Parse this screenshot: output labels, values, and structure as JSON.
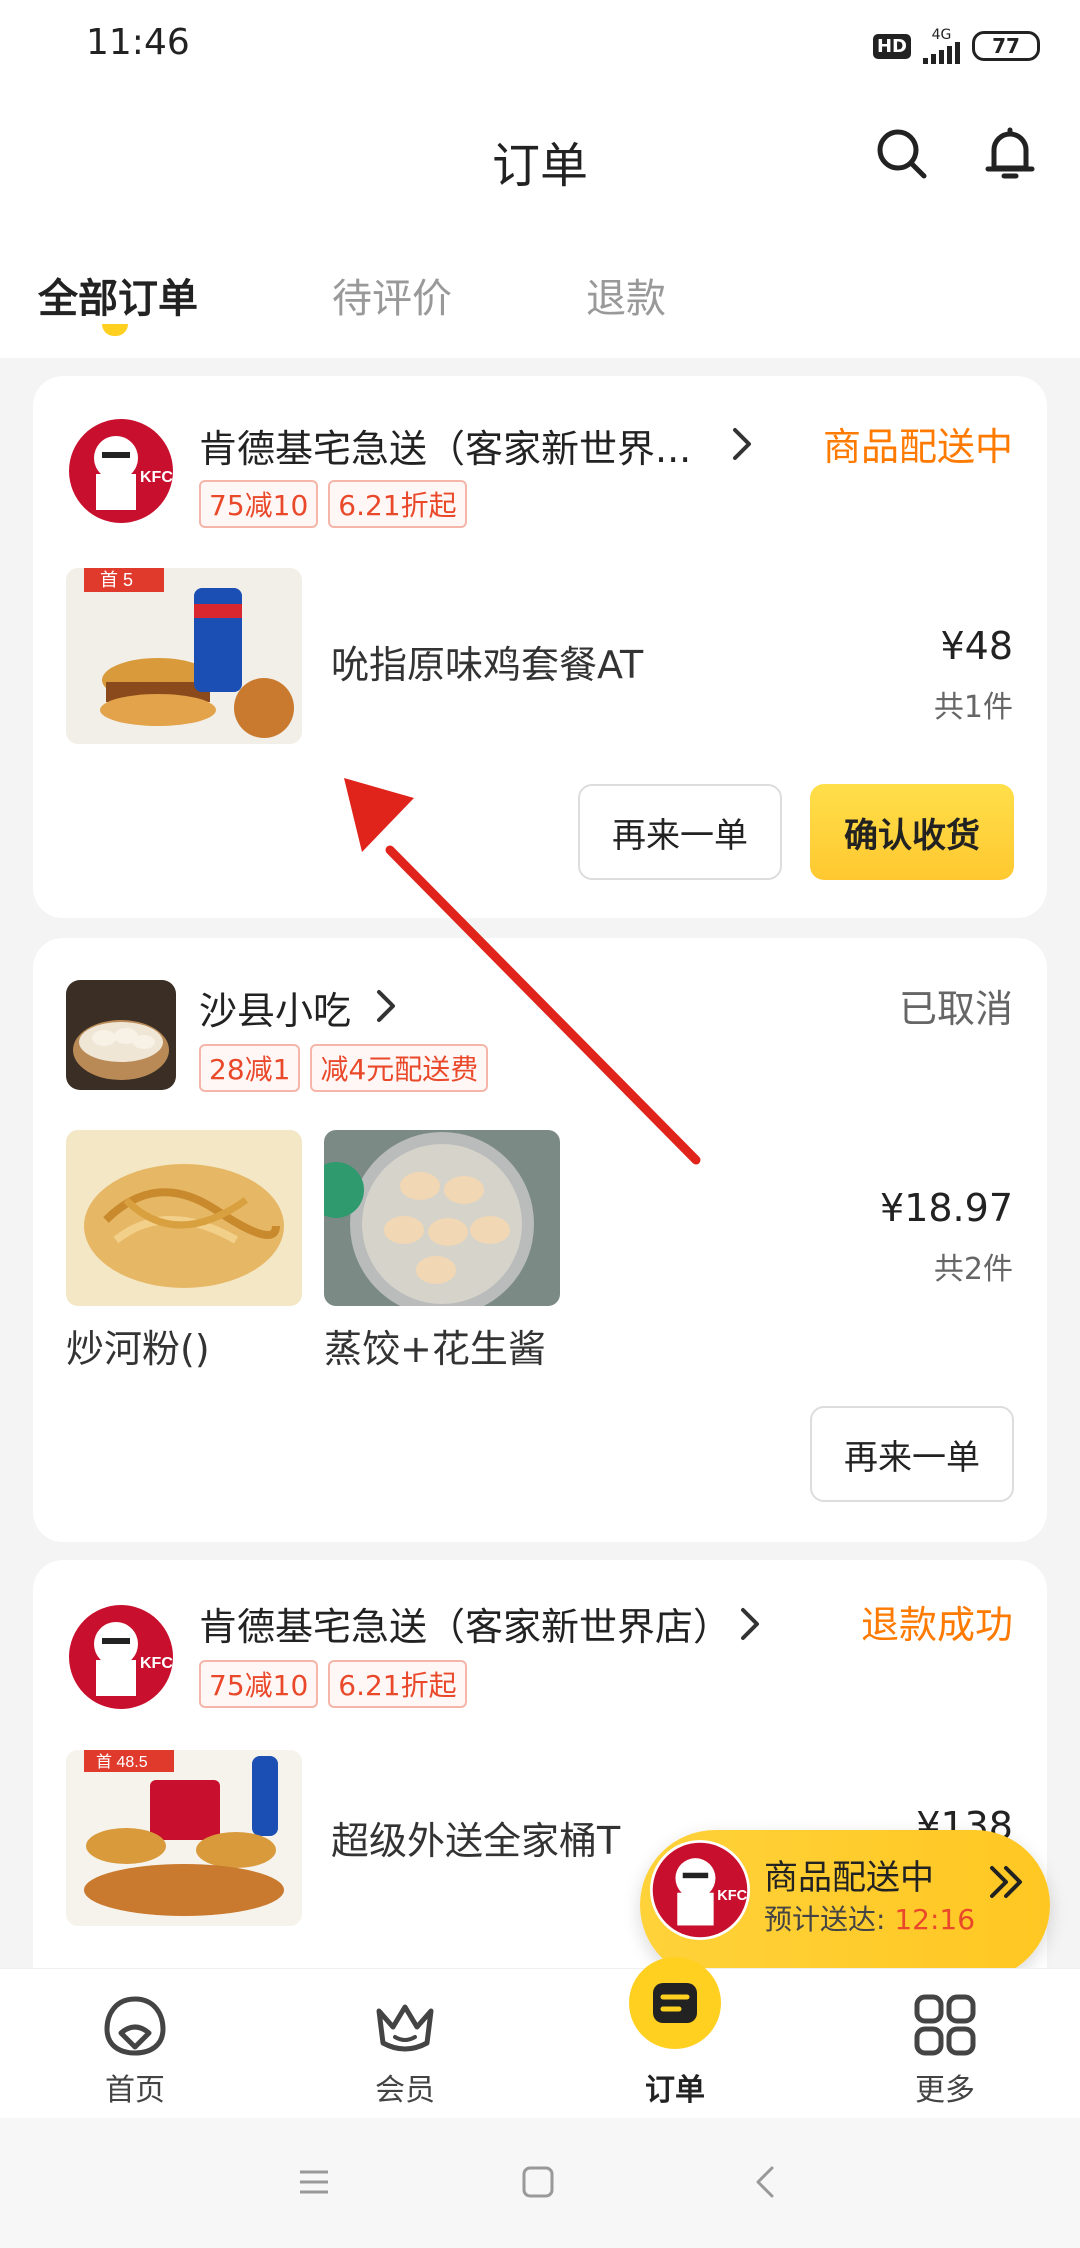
{
  "status_bar": {
    "time": "11:46",
    "hd": "HD",
    "network": "4G",
    "battery": "77"
  },
  "header": {
    "title": "订单"
  },
  "tabs": [
    {
      "label": "全部订单",
      "active": true
    },
    {
      "label": "待评价",
      "active": false
    },
    {
      "label": "退款",
      "active": false
    }
  ],
  "orders": [
    {
      "shop": "肯德基宅急送（客家新世界...",
      "status": "商品配送中",
      "status_color": "#ff7a00",
      "badges": [
        "75减10",
        "6.21折起"
      ],
      "items": [
        {
          "name": "吮指原味鸡套餐AT",
          "thumb_label": "首 5"
        }
      ],
      "price": "¥48",
      "count": "共1件",
      "buttons": [
        "再来一单",
        "确认收货"
      ]
    },
    {
      "shop": "沙县小吃",
      "status": "已取消",
      "status_color": "#666666",
      "badges": [
        "28减1",
        "减4元配送费"
      ],
      "items": [
        {
          "name": "炒河粉()"
        },
        {
          "name": "蒸饺+花生酱"
        }
      ],
      "price": "¥18.97",
      "count": "共2件",
      "buttons": [
        "再来一单"
      ]
    },
    {
      "shop": "肯德基宅急送（客家新世界店）",
      "status": "退款成功",
      "status_color": "#ff7a00",
      "badges": [
        "75减10",
        "6.21折起"
      ],
      "items": [
        {
          "name": "超级外送全家桶T",
          "thumb_label": "首 48.5"
        }
      ],
      "price": "¥138"
    }
  ],
  "delivery_banner": {
    "title": "商品配送中",
    "eta_label": "预计送达:",
    "eta_time": "12:16"
  },
  "bottom_nav": [
    {
      "label": "首页",
      "icon": "home-icon"
    },
    {
      "label": "会员",
      "icon": "crown-icon"
    },
    {
      "label": "订单",
      "icon": "order-icon",
      "active": true
    },
    {
      "label": "更多",
      "icon": "grid-icon"
    }
  ],
  "colors": {
    "accent_yellow": "#ffd020",
    "orange_status": "#ff7a00",
    "badge_red": "#e9492a"
  }
}
